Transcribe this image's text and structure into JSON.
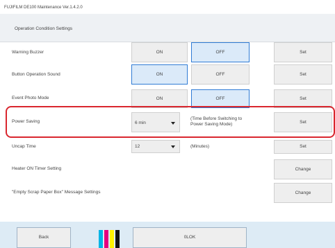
{
  "window": {
    "title": "FUJIFILM DE100 Maintenance Ver.1.4.2.0"
  },
  "header": {
    "title": "Operation Condition Settings"
  },
  "rows": [
    {
      "label": "Warning Buzzer",
      "on": "ON",
      "off": "OFF",
      "selected": "OFF",
      "set": "Set"
    },
    {
      "label": "Button Operation Sound",
      "on": "ON",
      "off": "OFF",
      "selected": "ON",
      "set": "Set"
    },
    {
      "label": "Event Photo Mode",
      "on": "ON",
      "off": "OFF",
      "selected": "OFF",
      "set": "Set"
    }
  ],
  "power_saving": {
    "label": "Power Saving",
    "value": "6 min",
    "note_line1": "(Time Before Switching to",
    "note_line2": "Power Saving Mode)",
    "set": "Set"
  },
  "uncap_time": {
    "label": "Uncap Time",
    "value": "12",
    "note": "(Minutes)",
    "set": "Set"
  },
  "heater": {
    "label": "Heater ON Timer Setting",
    "button": "Change"
  },
  "scrap_box": {
    "label": "\"Empty Scrap Paper Box\" Message Settings",
    "button": "Change"
  },
  "footer": {
    "back": "Back",
    "ok": "0LOK"
  },
  "colors": {
    "selected_fill": "#dbeaf9",
    "selected_border": "#2f7bd5",
    "highlight": "#d9262e",
    "footer_bg": "#ddebf5"
  },
  "ink_colors": [
    "#00b4e6",
    "#e6007e",
    "#fff200",
    "#111111"
  ]
}
